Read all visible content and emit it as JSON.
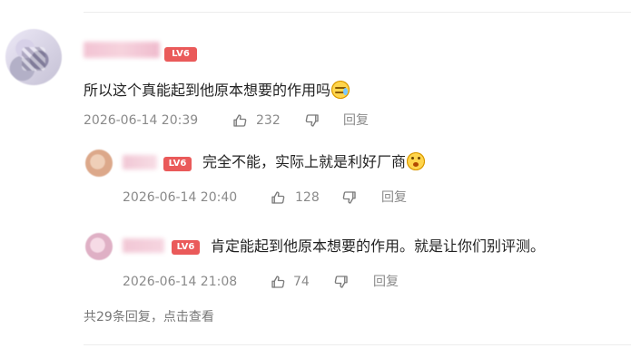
{
  "main_comment": {
    "badge": "LV6",
    "text": "所以这个真能起到他原本想要的作用吗",
    "emoji": "crying-face-emoji",
    "timestamp": "2026-06-14 20:39",
    "likes": "232",
    "reply_label": "回复"
  },
  "replies": [
    {
      "badge": "LV6",
      "text": "完全不能，实际上就是利好厂商",
      "emoji": "shocked-face-emoji",
      "timestamp": "2026-06-14 20:40",
      "likes": "128",
      "reply_label": "回复"
    },
    {
      "badge": "LV6",
      "text": "肯定能起到他原本想要的作用。就是让你们别评测。",
      "timestamp": "2026-06-14 21:08",
      "likes": "74",
      "reply_label": "回复"
    }
  ],
  "footer": {
    "more_replies": "共29条回复，点击查看"
  },
  "colors": {
    "badge": "#ea5a5a",
    "main_text": "#222222",
    "meta_text": "#8a8a8a",
    "divider": "#ededed"
  }
}
